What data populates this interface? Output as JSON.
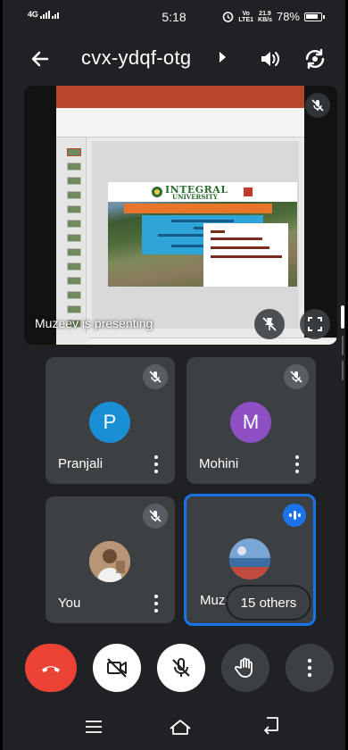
{
  "status_bar": {
    "network": "4G",
    "time": "5:18",
    "volte_top": "Vo",
    "volte_bottom": "LTE1",
    "speed_top": "21.9",
    "speed_bottom": "KB/s",
    "battery": "78%"
  },
  "header": {
    "meeting_code": "cvx-ydqf-otg"
  },
  "presentation": {
    "presenter_label": "Muzeev is presenting",
    "slide": {
      "university_name": "INTEGRAL",
      "university_sub": "UNIVERSITY"
    }
  },
  "participants": [
    {
      "name": "Pranjali",
      "initial": "P",
      "color": "#1a8fd6",
      "muted": true
    },
    {
      "name": "Mohini",
      "initial": "M",
      "color": "#8e4fc4",
      "muted": true
    },
    {
      "name": "You",
      "muted": true
    },
    {
      "name": "Muzeev",
      "speaking": true
    }
  ],
  "others_chip": "15 others",
  "colors": {
    "end_call": "#ea4335",
    "active_speaker": "#1a73e8",
    "tile_bg": "#3c4043",
    "screen_bg": "#202124"
  }
}
